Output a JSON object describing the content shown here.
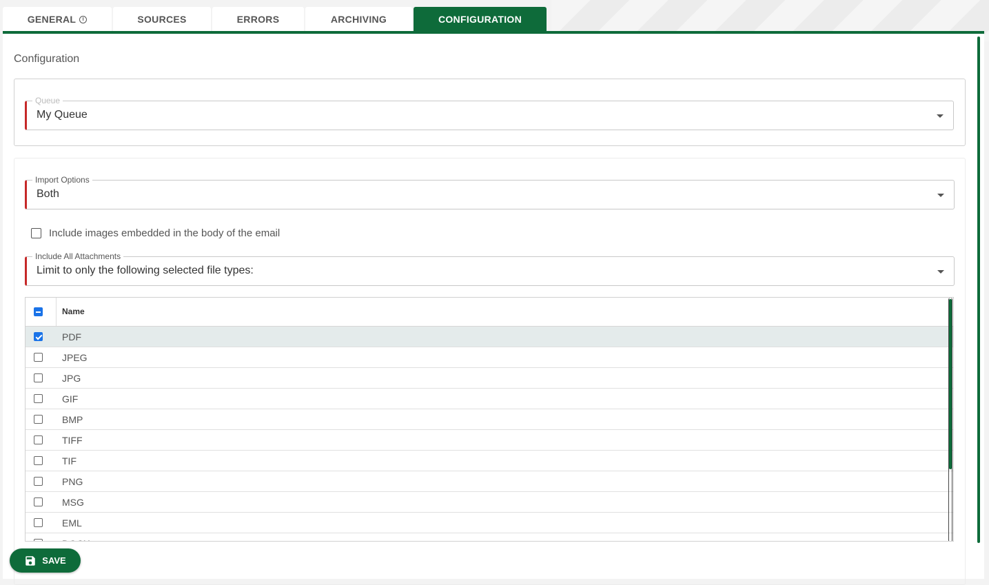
{
  "tabs": [
    {
      "label": "GENERAL",
      "active": false
    },
    {
      "label": "SOURCES",
      "active": false
    },
    {
      "label": "ERRORS",
      "active": false
    },
    {
      "label": "ARCHIVING",
      "active": false
    },
    {
      "label": "CONFIGURATION",
      "active": true
    }
  ],
  "section_title": "Configuration",
  "queue_field": {
    "label": "Queue",
    "value": "My Queue"
  },
  "import_options": {
    "label": "Import Options",
    "value": "Both"
  },
  "embedded_images": {
    "label": "Include images embedded in the body of the email",
    "checked": false
  },
  "attachments": {
    "label": "Include All Attachments",
    "value": "Limit to only the following selected file types:"
  },
  "grid": {
    "header": "Name",
    "rows": [
      {
        "name": "PDF",
        "checked": true
      },
      {
        "name": "JPEG",
        "checked": false
      },
      {
        "name": "JPG",
        "checked": false
      },
      {
        "name": "GIF",
        "checked": false
      },
      {
        "name": "BMP",
        "checked": false
      },
      {
        "name": "TIFF",
        "checked": false
      },
      {
        "name": "TIF",
        "checked": false
      },
      {
        "name": "PNG",
        "checked": false
      },
      {
        "name": "MSG",
        "checked": false
      },
      {
        "name": "EML",
        "checked": false
      },
      {
        "name": "DOCX",
        "checked": false
      }
    ]
  },
  "save_button": {
    "label": "SAVE"
  },
  "colors": {
    "accent": "#0e6b3a",
    "required": "#c62828",
    "checkbox": "#1a73e8"
  }
}
